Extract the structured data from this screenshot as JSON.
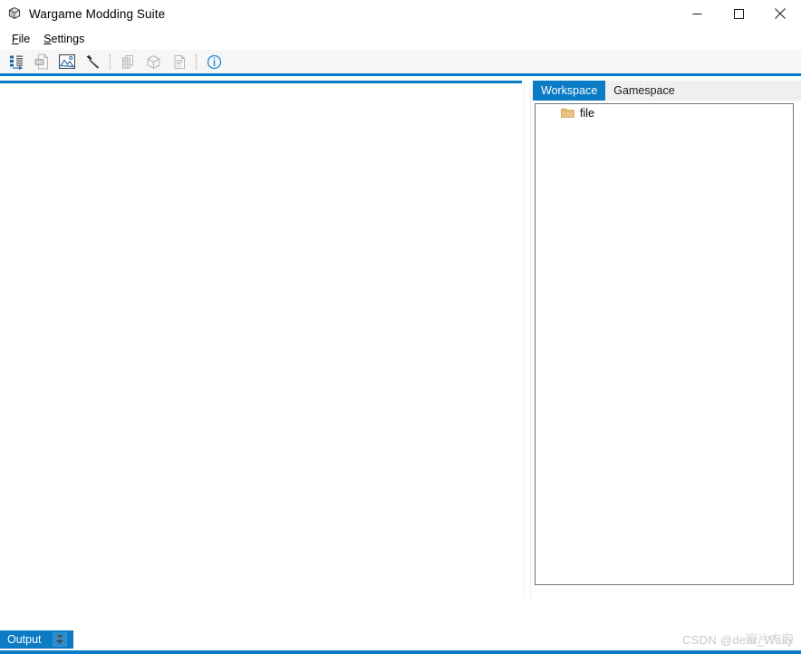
{
  "window": {
    "title": "Wargame Modding Suite",
    "app_icon": "cube-box-icon",
    "controls": {
      "minimize": "minimize-icon",
      "maximize": "maximize-icon",
      "close": "close-icon"
    }
  },
  "menubar": {
    "items": [
      {
        "label": "File",
        "accel": "F"
      },
      {
        "label": "Settings",
        "accel": "S"
      }
    ]
  },
  "toolbar": {
    "buttons": [
      {
        "icon": "import-data-icon",
        "tooltip": "Import",
        "enabled": true
      },
      {
        "icon": "export-file-icon",
        "tooltip": "Export",
        "enabled": false
      },
      {
        "icon": "image-icon",
        "tooltip": "Image",
        "enabled": true
      },
      {
        "icon": "wrench-icon",
        "tooltip": "Tools",
        "enabled": true
      },
      {
        "separator": true
      },
      {
        "icon": "table-copy-icon",
        "tooltip": "Tables",
        "enabled": false
      },
      {
        "icon": "cube-icon",
        "tooltip": "Model",
        "enabled": false
      },
      {
        "icon": "text-file-icon",
        "tooltip": "Script",
        "enabled": false
      },
      {
        "separator": true
      },
      {
        "icon": "info-circle-icon",
        "tooltip": "About",
        "enabled": true
      }
    ]
  },
  "right_panel": {
    "tabs": [
      {
        "label": "Workspace",
        "active": true
      },
      {
        "label": "Gamespace",
        "active": false
      }
    ],
    "tree": {
      "nodes": [
        {
          "label": "file",
          "icon": "folder-icon",
          "depth": 0
        }
      ]
    }
  },
  "bottom_dock": {
    "tab_label": "Output",
    "pin_icon": "pin-icon"
  },
  "watermark": {
    "text": "CSDN @dear_Wally",
    "overlay": "图片内容"
  },
  "colors": {
    "accent": "#0a7bc4",
    "toolbar_bg": "#f6f6f6",
    "tab_inactive_bg": "#efefef",
    "tree_border": "#6d7580",
    "folder": "#e8bd79"
  }
}
